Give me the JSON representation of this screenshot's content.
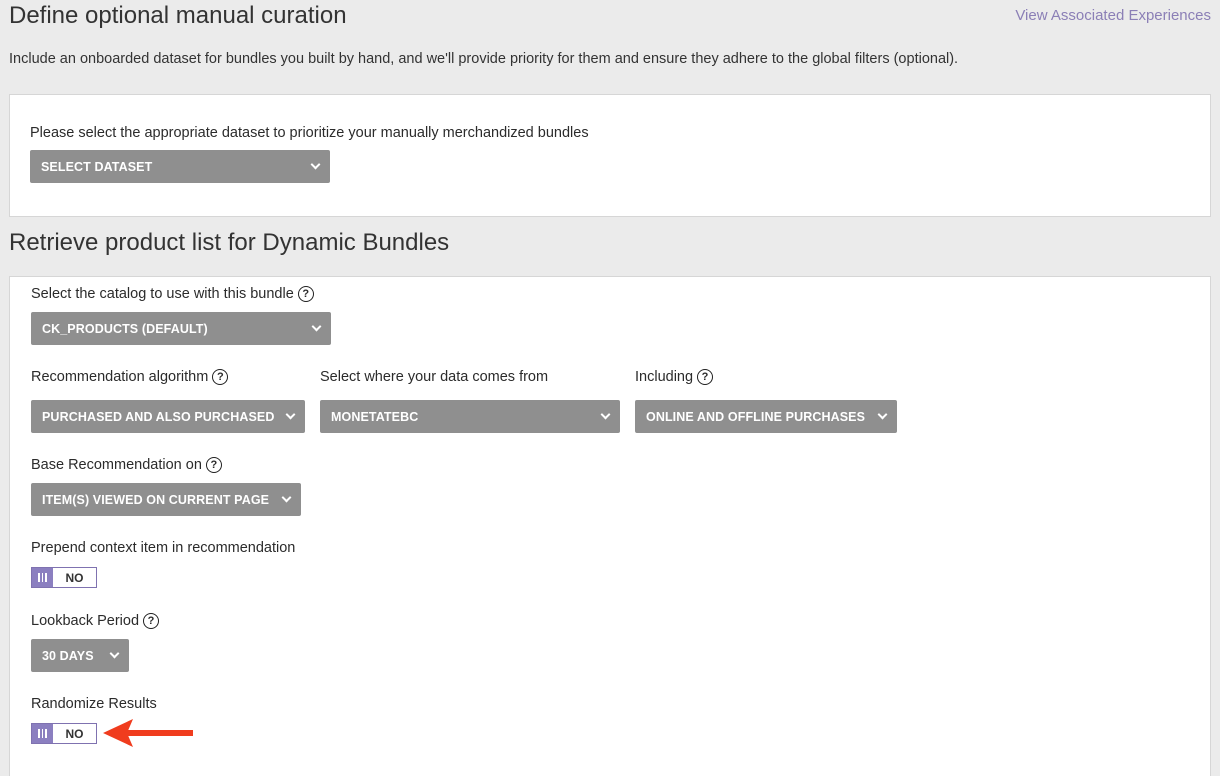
{
  "section1": {
    "title": "Define optional manual curation",
    "link": "View Associated Experiences",
    "description": "Include an onboarded dataset for bundles you built by hand, and we'll provide priority for them and ensure they adhere to the global filters (optional).",
    "dataset_label": "Please select the appropriate dataset to prioritize your manually merchandized bundles",
    "dataset_value": "SELECT DATASET"
  },
  "section2": {
    "title": "Retrieve product list for Dynamic Bundles",
    "catalog_label": "Select the catalog to use with this bundle",
    "catalog_value": "CK_PRODUCTS (DEFAULT)",
    "algorithm_label": "Recommendation algorithm",
    "algorithm_value": "PURCHASED AND ALSO PURCHASED",
    "source_label": "Select where your data comes from",
    "source_value": "MONETATEBC",
    "including_label": "Including",
    "including_value": "ONLINE AND OFFLINE PURCHASES",
    "base_label": "Base Recommendation on",
    "base_value": "ITEM(S) VIEWED ON CURRENT PAGE",
    "prepend_label": "Prepend context item in recommendation",
    "prepend_value": "NO",
    "lookback_label": "Lookback Period",
    "lookback_value": "30 DAYS",
    "randomize_label": "Randomize Results",
    "randomize_value": "NO"
  },
  "icons": {
    "help": "?",
    "annotation_arrow_color": "#f03c1e"
  }
}
